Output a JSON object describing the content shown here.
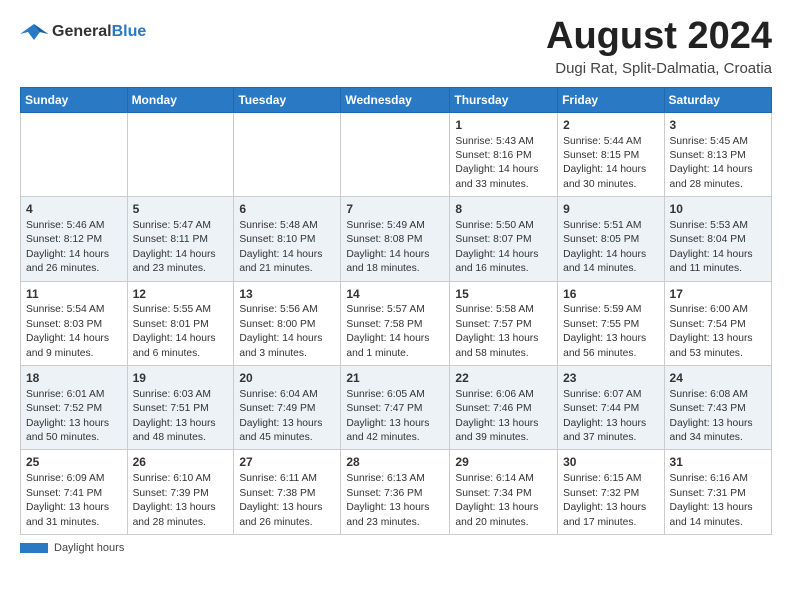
{
  "header": {
    "logo_line1": "General",
    "logo_line2": "Blue",
    "month": "August 2024",
    "location": "Dugi Rat, Split-Dalmatia, Croatia"
  },
  "legend": {
    "text": "Daylight hours"
  },
  "days_of_week": [
    "Sunday",
    "Monday",
    "Tuesday",
    "Wednesday",
    "Thursday",
    "Friday",
    "Saturday"
  ],
  "weeks": [
    [
      {
        "day": "",
        "info": ""
      },
      {
        "day": "",
        "info": ""
      },
      {
        "day": "",
        "info": ""
      },
      {
        "day": "",
        "info": ""
      },
      {
        "day": "1",
        "info": "Sunrise: 5:43 AM\nSunset: 8:16 PM\nDaylight: 14 hours and 33 minutes."
      },
      {
        "day": "2",
        "info": "Sunrise: 5:44 AM\nSunset: 8:15 PM\nDaylight: 14 hours and 30 minutes."
      },
      {
        "day": "3",
        "info": "Sunrise: 5:45 AM\nSunset: 8:13 PM\nDaylight: 14 hours and 28 minutes."
      }
    ],
    [
      {
        "day": "4",
        "info": "Sunrise: 5:46 AM\nSunset: 8:12 PM\nDaylight: 14 hours and 26 minutes."
      },
      {
        "day": "5",
        "info": "Sunrise: 5:47 AM\nSunset: 8:11 PM\nDaylight: 14 hours and 23 minutes."
      },
      {
        "day": "6",
        "info": "Sunrise: 5:48 AM\nSunset: 8:10 PM\nDaylight: 14 hours and 21 minutes."
      },
      {
        "day": "7",
        "info": "Sunrise: 5:49 AM\nSunset: 8:08 PM\nDaylight: 14 hours and 18 minutes."
      },
      {
        "day": "8",
        "info": "Sunrise: 5:50 AM\nSunset: 8:07 PM\nDaylight: 14 hours and 16 minutes."
      },
      {
        "day": "9",
        "info": "Sunrise: 5:51 AM\nSunset: 8:05 PM\nDaylight: 14 hours and 14 minutes."
      },
      {
        "day": "10",
        "info": "Sunrise: 5:53 AM\nSunset: 8:04 PM\nDaylight: 14 hours and 11 minutes."
      }
    ],
    [
      {
        "day": "11",
        "info": "Sunrise: 5:54 AM\nSunset: 8:03 PM\nDaylight: 14 hours and 9 minutes."
      },
      {
        "day": "12",
        "info": "Sunrise: 5:55 AM\nSunset: 8:01 PM\nDaylight: 14 hours and 6 minutes."
      },
      {
        "day": "13",
        "info": "Sunrise: 5:56 AM\nSunset: 8:00 PM\nDaylight: 14 hours and 3 minutes."
      },
      {
        "day": "14",
        "info": "Sunrise: 5:57 AM\nSunset: 7:58 PM\nDaylight: 14 hours and 1 minute."
      },
      {
        "day": "15",
        "info": "Sunrise: 5:58 AM\nSunset: 7:57 PM\nDaylight: 13 hours and 58 minutes."
      },
      {
        "day": "16",
        "info": "Sunrise: 5:59 AM\nSunset: 7:55 PM\nDaylight: 13 hours and 56 minutes."
      },
      {
        "day": "17",
        "info": "Sunrise: 6:00 AM\nSunset: 7:54 PM\nDaylight: 13 hours and 53 minutes."
      }
    ],
    [
      {
        "day": "18",
        "info": "Sunrise: 6:01 AM\nSunset: 7:52 PM\nDaylight: 13 hours and 50 minutes."
      },
      {
        "day": "19",
        "info": "Sunrise: 6:03 AM\nSunset: 7:51 PM\nDaylight: 13 hours and 48 minutes."
      },
      {
        "day": "20",
        "info": "Sunrise: 6:04 AM\nSunset: 7:49 PM\nDaylight: 13 hours and 45 minutes."
      },
      {
        "day": "21",
        "info": "Sunrise: 6:05 AM\nSunset: 7:47 PM\nDaylight: 13 hours and 42 minutes."
      },
      {
        "day": "22",
        "info": "Sunrise: 6:06 AM\nSunset: 7:46 PM\nDaylight: 13 hours and 39 minutes."
      },
      {
        "day": "23",
        "info": "Sunrise: 6:07 AM\nSunset: 7:44 PM\nDaylight: 13 hours and 37 minutes."
      },
      {
        "day": "24",
        "info": "Sunrise: 6:08 AM\nSunset: 7:43 PM\nDaylight: 13 hours and 34 minutes."
      }
    ],
    [
      {
        "day": "25",
        "info": "Sunrise: 6:09 AM\nSunset: 7:41 PM\nDaylight: 13 hours and 31 minutes."
      },
      {
        "day": "26",
        "info": "Sunrise: 6:10 AM\nSunset: 7:39 PM\nDaylight: 13 hours and 28 minutes."
      },
      {
        "day": "27",
        "info": "Sunrise: 6:11 AM\nSunset: 7:38 PM\nDaylight: 13 hours and 26 minutes."
      },
      {
        "day": "28",
        "info": "Sunrise: 6:13 AM\nSunset: 7:36 PM\nDaylight: 13 hours and 23 minutes."
      },
      {
        "day": "29",
        "info": "Sunrise: 6:14 AM\nSunset: 7:34 PM\nDaylight: 13 hours and 20 minutes."
      },
      {
        "day": "30",
        "info": "Sunrise: 6:15 AM\nSunset: 7:32 PM\nDaylight: 13 hours and 17 minutes."
      },
      {
        "day": "31",
        "info": "Sunrise: 6:16 AM\nSunset: 7:31 PM\nDaylight: 13 hours and 14 minutes."
      }
    ]
  ]
}
